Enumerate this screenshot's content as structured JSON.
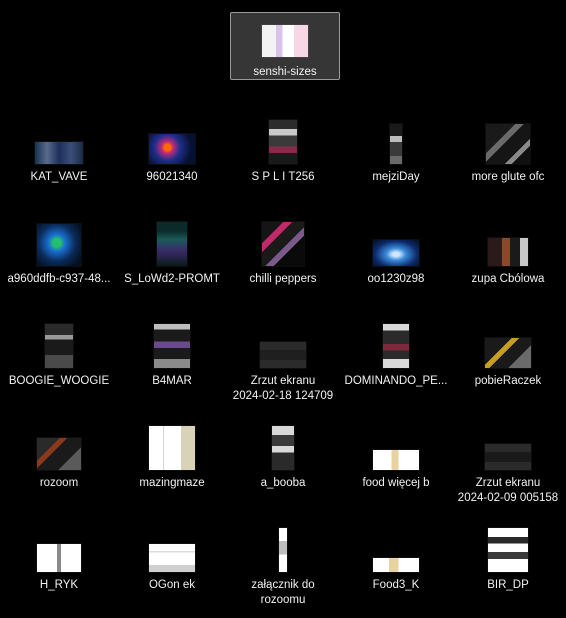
{
  "desktop": {
    "selected_item": {
      "name": "senshi-sizes",
      "icon": "image-thumbnail-icon"
    },
    "items": [
      {
        "name": "KAT_VAVE",
        "icon": "image-thumbnail-icon"
      },
      {
        "name": "96021340",
        "icon": "image-thumbnail-icon"
      },
      {
        "name": "S P L I T256",
        "icon": "image-thumbnail-icon"
      },
      {
        "name": "mejziDay",
        "icon": "image-thumbnail-icon"
      },
      {
        "name": "more glute ofc",
        "icon": "image-thumbnail-icon"
      },
      {
        "name": "a960ddfb-c937-48...",
        "icon": "image-thumbnail-icon"
      },
      {
        "name": "S_LoWd2-PROMT",
        "icon": "image-thumbnail-icon"
      },
      {
        "name": "chilli peppers",
        "icon": "image-thumbnail-icon"
      },
      {
        "name": "oo1230z98",
        "icon": "image-thumbnail-icon"
      },
      {
        "name": "zupa Cbólowa",
        "icon": "image-thumbnail-icon"
      },
      {
        "name": "BOOGIE_WOOGIE",
        "icon": "image-thumbnail-icon"
      },
      {
        "name": "B4MAR",
        "icon": "image-thumbnail-icon"
      },
      {
        "name": "Zrzut ekranu\n2024-02-18 124709",
        "icon": "screenshot-thumbnail-icon"
      },
      {
        "name": "DOMINANDO_PE...",
        "icon": "image-thumbnail-icon"
      },
      {
        "name": "pobieRaczek",
        "icon": "image-thumbnail-icon"
      },
      {
        "name": "rozoom",
        "icon": "image-thumbnail-icon"
      },
      {
        "name": "mazingmaze",
        "icon": "image-thumbnail-icon"
      },
      {
        "name": "a_booba",
        "icon": "image-thumbnail-icon"
      },
      {
        "name": "food więcej b",
        "icon": "image-thumbnail-icon"
      },
      {
        "name": "Zrzut ekranu\n2024-02-09 005158",
        "icon": "screenshot-thumbnail-icon"
      },
      {
        "name": "H_RYK",
        "icon": "image-thumbnail-icon"
      },
      {
        "name": "OGon ek",
        "icon": "image-thumbnail-icon"
      },
      {
        "name": "załącznik do\nrozoomu",
        "icon": "image-thumbnail-icon"
      },
      {
        "name": "Food3_K",
        "icon": "image-thumbnail-icon"
      },
      {
        "name": "BIR_DP",
        "icon": "image-thumbnail-icon"
      }
    ]
  },
  "colors": {
    "background": "#000000",
    "selection_fill": "#5a5a5a",
    "selection_border": "#9a9a9a",
    "label": "#f2f2f2"
  }
}
